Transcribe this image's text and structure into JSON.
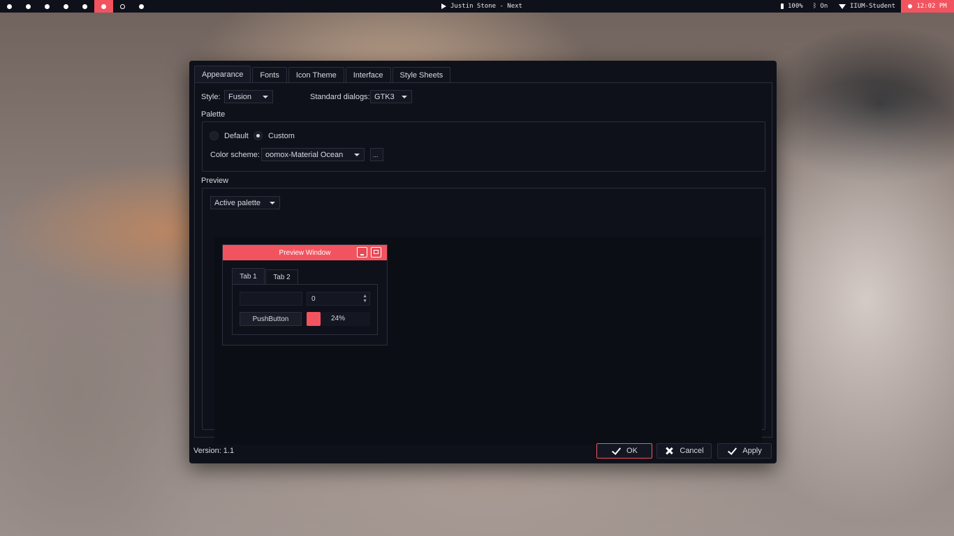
{
  "topbar": {
    "workspaces": [
      {
        "state": "filled"
      },
      {
        "state": "filled"
      },
      {
        "state": "filled"
      },
      {
        "state": "filled"
      },
      {
        "state": "filled"
      },
      {
        "state": "active"
      },
      {
        "state": "empty"
      },
      {
        "state": "filled"
      }
    ],
    "media": "Justin Stone - Next",
    "battery": "100%",
    "bluetooth": "On",
    "wifi": "IIUM-Student",
    "clock": "12:02 PM",
    "accent": "#f2545f"
  },
  "dialog": {
    "tabs": [
      "Appearance",
      "Fonts",
      "Icon Theme",
      "Interface",
      "Style Sheets"
    ],
    "active_tab": "Appearance",
    "style_label": "Style:",
    "style_value": "Fusion",
    "standard_dialogs_label": "Standard dialogs:",
    "standard_dialogs_value": "GTK3",
    "palette_label": "Palette",
    "radio_default": "Default",
    "radio_custom": "Custom",
    "selected_palette": "Custom",
    "color_scheme_label": "Color scheme:",
    "color_scheme_value": "oomox-Material Ocean",
    "more_button": "...",
    "preview_label": "Preview",
    "preview_palette": "Active palette",
    "preview_window": {
      "title": "Preview Window",
      "tab1": "Tab 1",
      "tab2": "Tab 2",
      "spin_value": "0",
      "push_button": "PushButton",
      "progress": "24%"
    },
    "version": "Version: 1.1",
    "ok": "OK",
    "cancel": "Cancel",
    "apply": "Apply"
  }
}
